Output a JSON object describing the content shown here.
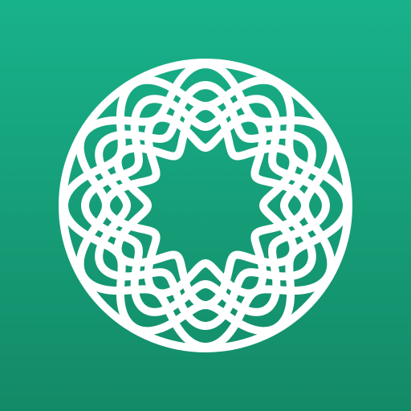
{
  "icon": {
    "name": "interlaced-knot-logo-icon",
    "colors": {
      "background_top": "#18B28A",
      "background_bottom": "#138A67",
      "line": "#FFFFFF"
    }
  }
}
